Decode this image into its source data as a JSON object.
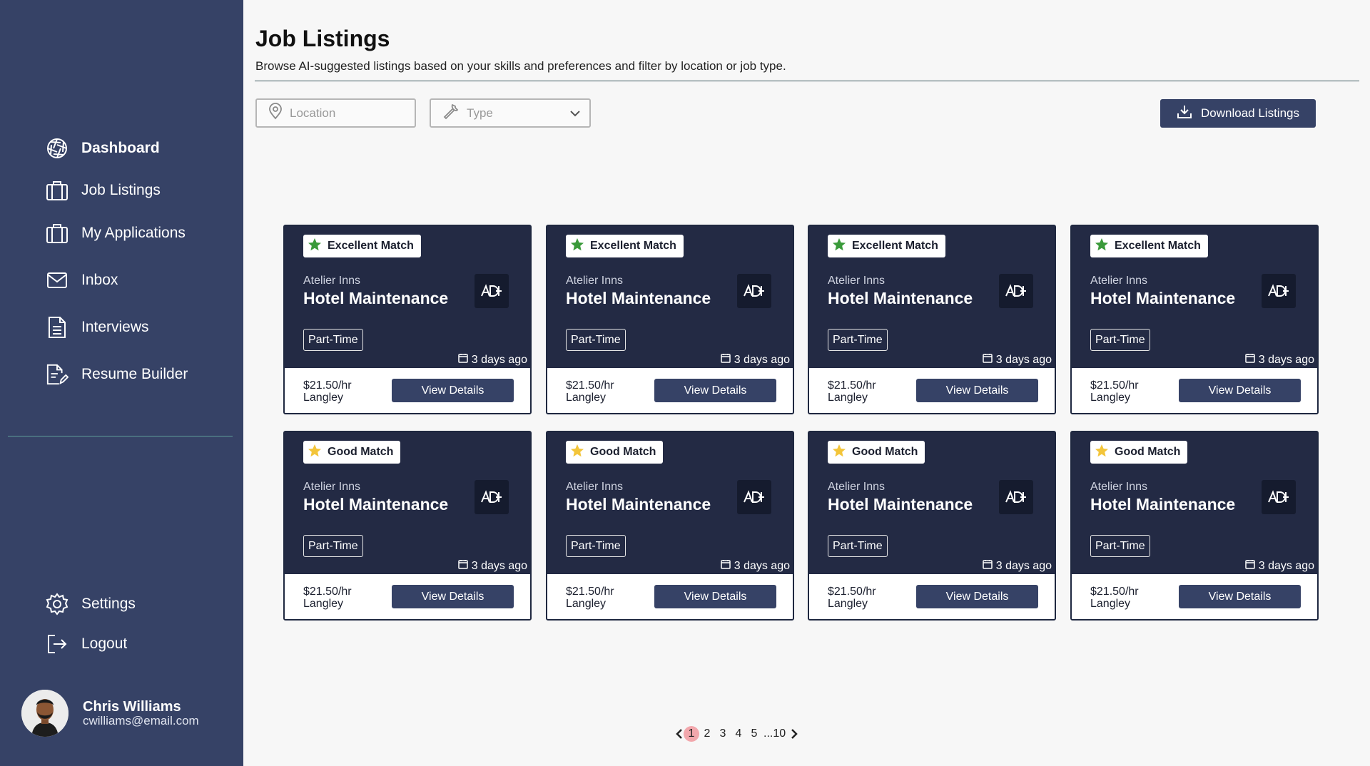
{
  "sidebar": {
    "nav": [
      {
        "label": "Dashboard",
        "icon": "dashboard-icon",
        "active": true
      },
      {
        "label": "Job Listings",
        "icon": "briefcase-icon"
      },
      {
        "label": "My Applications",
        "icon": "briefcase-icon"
      },
      {
        "label": "Inbox",
        "icon": "mail-icon"
      },
      {
        "label": "Interviews",
        "icon": "document-icon"
      },
      {
        "label": "Resume Builder",
        "icon": "edit-document-icon"
      }
    ],
    "bottom_nav": [
      {
        "label": "Settings",
        "icon": "gear-icon"
      },
      {
        "label": "Logout",
        "icon": "logout-icon"
      }
    ],
    "user": {
      "name": "Chris Williams",
      "email": "cwilliams@email.com"
    }
  },
  "header": {
    "title": "Job Listings",
    "subtitle": "Browse AI-suggested listings based on your skills and preferences and filter by location or job type."
  },
  "filters": {
    "location_placeholder": "Location",
    "type_placeholder": "Type",
    "download_label": "Download Listings"
  },
  "colors": {
    "sidebar": "#364266",
    "card": "#232a44",
    "excellent_star": "#3a9a3a",
    "good_star": "#f3c53a"
  },
  "cards": [
    {
      "match": "Excellent Match",
      "company": "Atelier Inns",
      "title": "Hotel Maintenance",
      "type": "Part-Time",
      "posted": "3 days ago",
      "pay": "$21.50/hr",
      "location": "Langley",
      "button": "View Details"
    },
    {
      "match": "Excellent Match",
      "company": "Atelier Inns",
      "title": "Hotel Maintenance",
      "type": "Part-Time",
      "posted": "3 days ago",
      "pay": "$21.50/hr",
      "location": "Langley",
      "button": "View Details"
    },
    {
      "match": "Excellent Match",
      "company": "Atelier Inns",
      "title": "Hotel Maintenance",
      "type": "Part-Time",
      "posted": "3 days ago",
      "pay": "$21.50/hr",
      "location": "Langley",
      "button": "View Details"
    },
    {
      "match": "Excellent Match",
      "company": "Atelier Inns",
      "title": "Hotel Maintenance",
      "type": "Part-Time",
      "posted": "3 days ago",
      "pay": "$21.50/hr",
      "location": "Langley",
      "button": "View Details"
    },
    {
      "match": "Good Match",
      "company": "Atelier Inns",
      "title": "Hotel Maintenance",
      "type": "Part-Time",
      "posted": "3 days ago",
      "pay": "$21.50/hr",
      "location": "Langley",
      "button": "View Details"
    },
    {
      "match": "Good Match",
      "company": "Atelier Inns",
      "title": "Hotel Maintenance",
      "type": "Part-Time",
      "posted": "3 days ago",
      "pay": "$21.50/hr",
      "location": "Langley",
      "button": "View Details"
    },
    {
      "match": "Good Match",
      "company": "Atelier Inns",
      "title": "Hotel Maintenance",
      "type": "Part-Time",
      "posted": "3 days ago",
      "pay": "$21.50/hr",
      "location": "Langley",
      "button": "View Details"
    },
    {
      "match": "Good Match",
      "company": "Atelier Inns",
      "title": "Hotel Maintenance",
      "type": "Part-Time",
      "posted": "3 days ago",
      "pay": "$21.50/hr",
      "location": "Langley",
      "button": "View Details"
    }
  ],
  "pagination": {
    "pages": [
      "1",
      "2",
      "3",
      "4",
      "5",
      "...10"
    ],
    "current": "1"
  }
}
